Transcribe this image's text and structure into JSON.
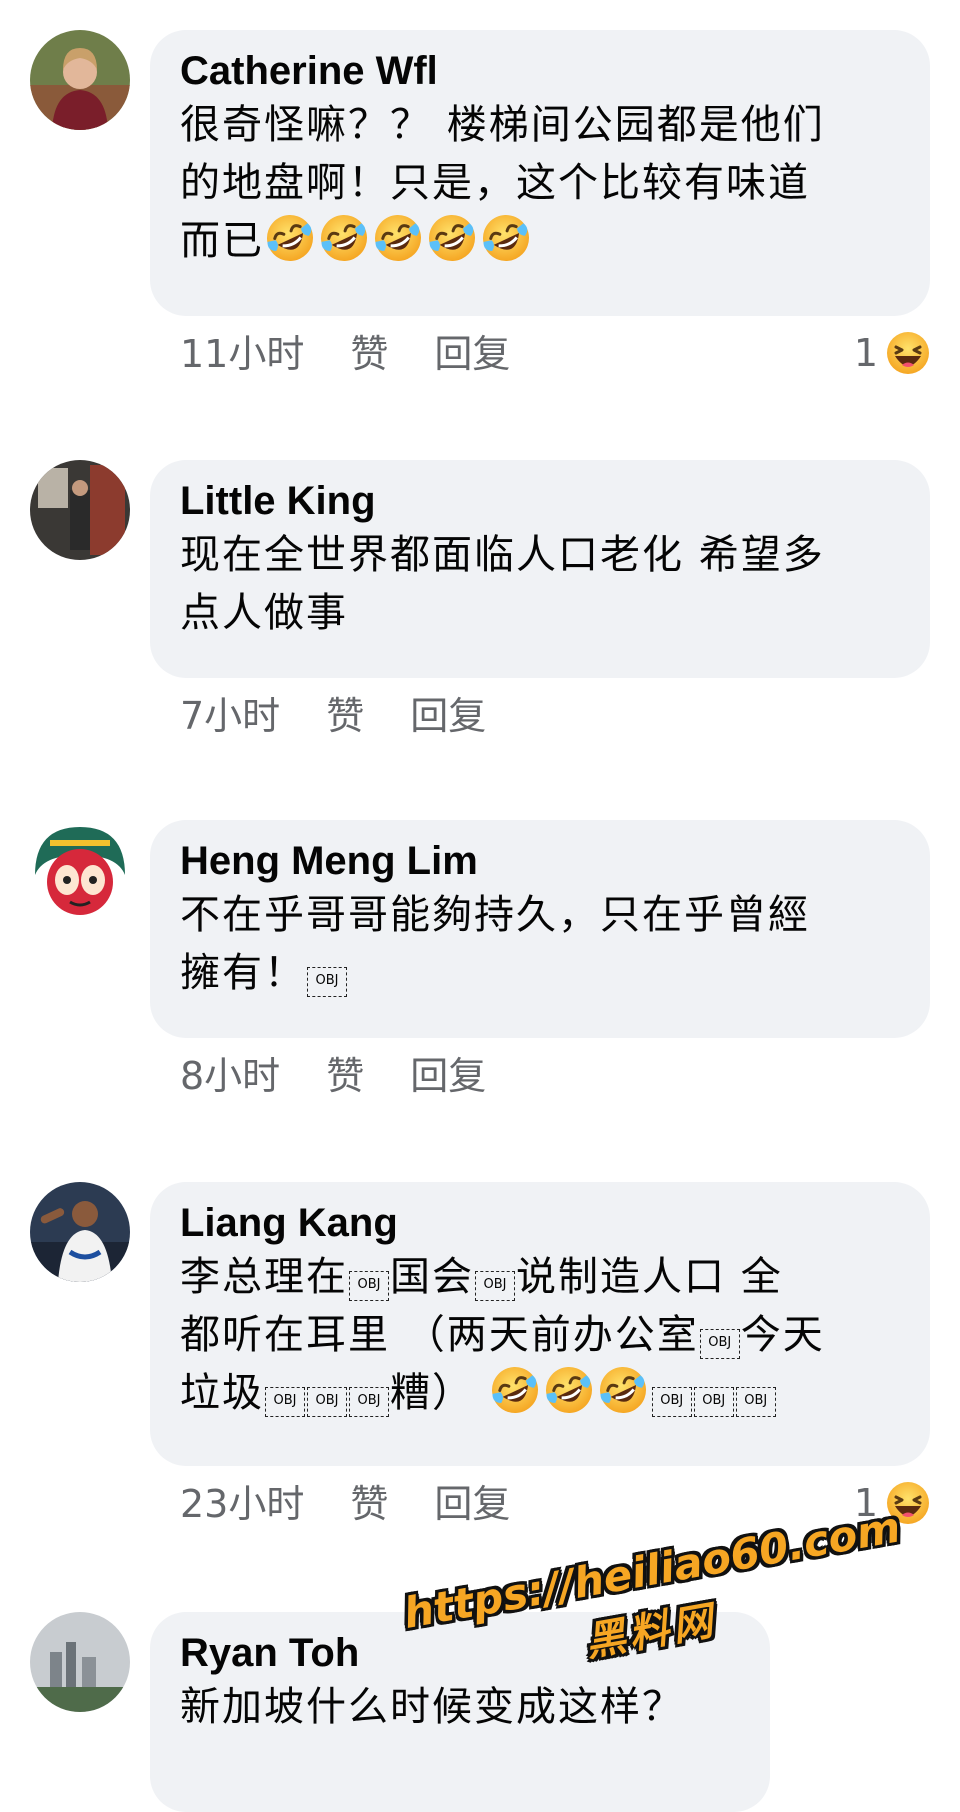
{
  "comments": [
    {
      "author": "Catherine Wfl",
      "lines": [
        "很奇怪嘛？？ 楼梯间公园都是他们",
        "的地盘啊！只是，这个比较有味道",
        "而已"
      ],
      "time": "11小时",
      "like": "赞",
      "reply": "回复",
      "reaction_count": "1"
    },
    {
      "author": "Little King",
      "lines": [
        "现在全世界都面临人口老化 希望多",
        "点人做事"
      ],
      "time": "7小时",
      "like": "赞",
      "reply": "回复"
    },
    {
      "author": "Heng Meng Lim",
      "lines": [
        "不在乎哥哥能夠持久，只在乎曾經",
        "擁有！"
      ],
      "time": "8小时",
      "like": "赞",
      "reply": "回复"
    },
    {
      "author": "Liang Kang",
      "lines": [
        "李总理在",
        "国会",
        "说制造人口 全",
        "都听在耳里 （两天前办公室",
        "今天",
        "垃圾",
        "糟）"
      ],
      "time": "23小时",
      "like": "赞",
      "reply": "回复",
      "reaction_count": "1"
    },
    {
      "author": "Ryan Toh",
      "lines": [
        "新加坡什么时候变成这样？"
      ]
    }
  ],
  "obj_placeholder": "OBJ",
  "icons": {
    "laugh_cry": "rolling-on-floor-laughing-icon",
    "haha": "haha-reaction-icon"
  },
  "watermark": {
    "url": "https://heiliao60.com",
    "name": "黑料网"
  },
  "colors": {
    "bubble": "#f0f2f5",
    "meta": "#65676b",
    "watermark": "#f6a623"
  }
}
